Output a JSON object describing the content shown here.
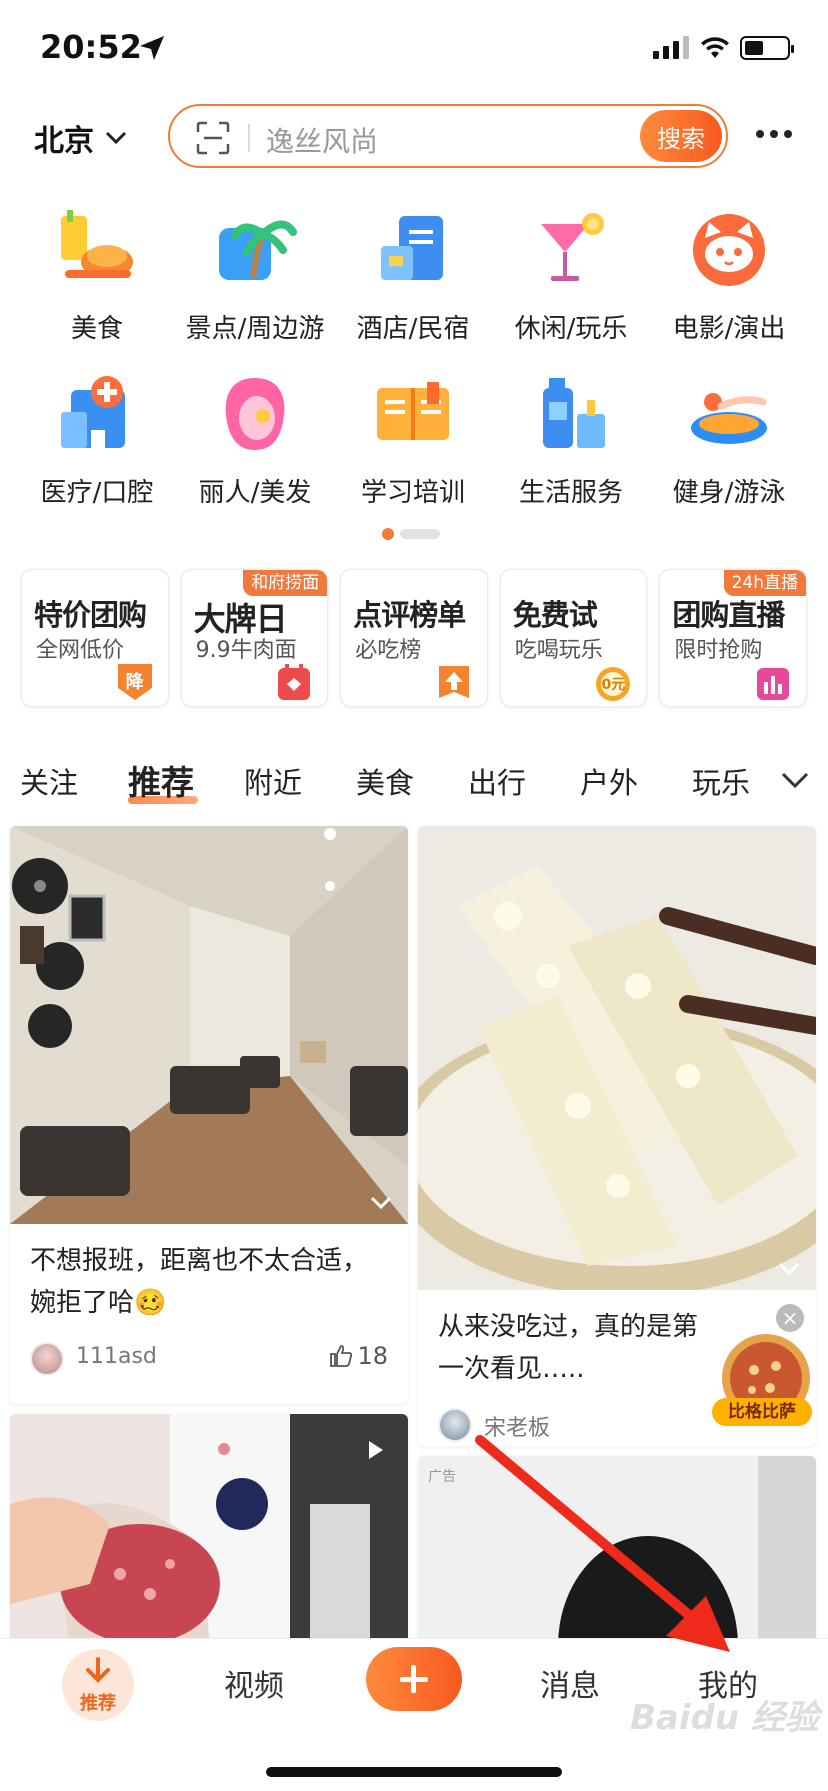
{
  "status_bar": {
    "time": "20:52",
    "battery_level": 0.45
  },
  "header": {
    "city": "北京",
    "search_placeholder": "逸丝风尚",
    "search_button": "搜索"
  },
  "categories": [
    {
      "label": "美食",
      "icon": "food-icon"
    },
    {
      "label": "景点/周边游",
      "icon": "palm-tree-icon"
    },
    {
      "label": "酒店/民宿",
      "icon": "hotel-icon"
    },
    {
      "label": "休闲/玩乐",
      "icon": "cocktail-icon"
    },
    {
      "label": "电影/演出",
      "icon": "cat-face-icon"
    },
    {
      "label": "医疗/口腔",
      "icon": "medical-icon"
    },
    {
      "label": "丽人/美发",
      "icon": "beauty-icon"
    },
    {
      "label": "学习培训",
      "icon": "book-icon"
    },
    {
      "label": "生活服务",
      "icon": "cleaning-icon"
    },
    {
      "label": "健身/游泳",
      "icon": "swimmer-icon"
    }
  ],
  "promos": [
    {
      "title": "特价团购",
      "subtitle": "全网低价",
      "tag": "",
      "badge": "降",
      "badge_color": "#f5822f"
    },
    {
      "title": "大牌日",
      "subtitle": "9.9牛肉面",
      "tag": "和府捞面",
      "badge": "",
      "badge_color": "#ee4b4b"
    },
    {
      "title": "点评榜单",
      "subtitle": "必吃榜",
      "tag": "",
      "badge": "",
      "badge_color": "#f5822f"
    },
    {
      "title": "免费试",
      "subtitle": "吃喝玩乐",
      "tag": "",
      "badge": "0元",
      "badge_color": "#f5a623"
    },
    {
      "title": "团购直播",
      "subtitle": "限时抢购",
      "tag": "24h直播",
      "badge": "",
      "badge_color": "#e8489a"
    }
  ],
  "tabs": [
    "关注",
    "推荐",
    "附近",
    "美食",
    "出行",
    "户外",
    "玩乐"
  ],
  "feed": {
    "card1": {
      "title": "不想报班，距离也不太合适，婉拒了哈🥴",
      "author": "111asd",
      "likes": "18"
    },
    "card2": {
      "title": "从来没吃过，真的是第一次看见…..",
      "author": "宋老板",
      "ad_button": "比格比萨"
    },
    "card4": {
      "ad_tag": "广告"
    }
  },
  "bottom_nav": {
    "recommend": "推荐",
    "video": "视频",
    "messages": "消息",
    "mine": "我的"
  },
  "watermark": "Baidu 经验",
  "colors": {
    "accent": "#f37a3a",
    "annotation_arrow": "#ee2a1a"
  }
}
